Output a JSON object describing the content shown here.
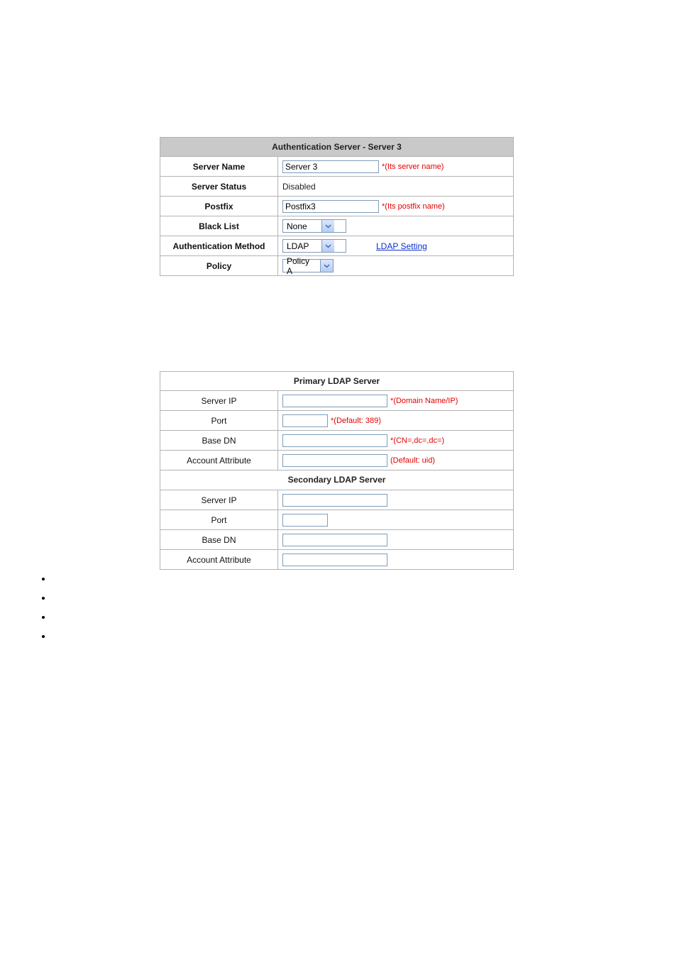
{
  "auth_panel": {
    "title": "Authentication Server - Server 3",
    "rows": {
      "server_name": {
        "label": "Server Name",
        "value": "Server 3",
        "hint": "*(Its server name)"
      },
      "server_status": {
        "label": "Server Status",
        "value": "Disabled"
      },
      "postfix": {
        "label": "Postfix",
        "value": "Postfix3",
        "hint": "*(Its postfix name)"
      },
      "black_list": {
        "label": "Black List",
        "value": "None"
      },
      "auth_method": {
        "label": "Authentication Method",
        "value": "LDAP",
        "link": "LDAP Setting"
      },
      "policy": {
        "label": "Policy",
        "value": "Policy A"
      }
    }
  },
  "ldap_panel": {
    "primary_title": "Primary LDAP Server",
    "secondary_title": "Secondary LDAP Server",
    "primary": {
      "server_ip": {
        "label": "Server IP",
        "value": "",
        "hint": "*(Domain Name/IP)"
      },
      "port": {
        "label": "Port",
        "value": "",
        "hint": "*(Default: 389)"
      },
      "base_dn": {
        "label": "Base DN",
        "value": "",
        "hint": "*(CN=,dc=,dc=)"
      },
      "account_attr": {
        "label": "Account Attribute",
        "value": "",
        "hint": "(Default: uid)"
      }
    },
    "secondary": {
      "server_ip": {
        "label": "Server IP",
        "value": ""
      },
      "port": {
        "label": "Port",
        "value": ""
      },
      "base_dn": {
        "label": "Base DN",
        "value": ""
      },
      "account_attr": {
        "label": "Account Attribute",
        "value": ""
      }
    }
  },
  "bullets": [
    "",
    "",
    "",
    ""
  ]
}
